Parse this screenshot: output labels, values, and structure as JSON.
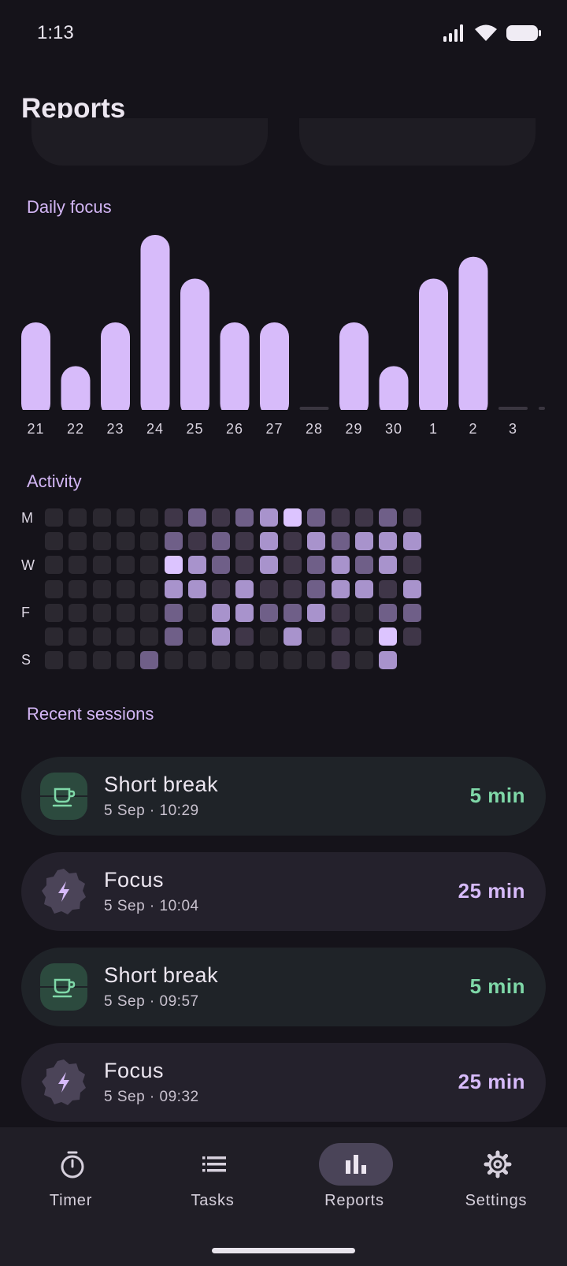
{
  "status_bar": {
    "time": "1:13"
  },
  "header": {
    "title": "Reports"
  },
  "daily_focus": {
    "title": "Daily focus"
  },
  "chart_data": {
    "type": "bar",
    "categories": [
      "21",
      "22",
      "23",
      "24",
      "25",
      "26",
      "27",
      "28",
      "29",
      "30",
      "1",
      "2",
      "3"
    ],
    "values": [
      2,
      1,
      2,
      4,
      3,
      2,
      2,
      0,
      2,
      1,
      3,
      3.5,
      0
    ],
    "ylim": [
      0,
      4
    ]
  },
  "activity": {
    "title": "Activity",
    "day_labels": [
      "M",
      "",
      "W",
      "",
      "F",
      "",
      "S"
    ],
    "levels": [
      [
        0,
        0,
        0,
        0,
        0,
        1,
        2,
        1,
        2,
        3,
        4,
        2,
        1,
        1,
        2,
        1
      ],
      [
        0,
        0,
        0,
        0,
        0,
        2,
        1,
        2,
        1,
        3,
        1,
        3,
        2,
        3,
        3,
        3
      ],
      [
        0,
        0,
        0,
        0,
        0,
        4,
        3,
        2,
        1,
        3,
        1,
        2,
        3,
        2,
        3,
        1
      ],
      [
        0,
        0,
        0,
        0,
        0,
        3,
        3,
        1,
        3,
        1,
        1,
        2,
        3,
        3,
        1,
        3
      ],
      [
        0,
        0,
        0,
        0,
        0,
        2,
        0,
        3,
        3,
        2,
        2,
        3,
        1,
        0,
        2,
        2
      ],
      [
        0,
        0,
        0,
        0,
        0,
        2,
        0,
        3,
        1,
        0,
        3,
        0,
        1,
        0,
        4,
        1
      ],
      [
        0,
        0,
        0,
        0,
        2,
        0,
        0,
        0,
        0,
        0,
        0,
        0,
        1,
        0,
        3,
        -1
      ]
    ]
  },
  "recent": {
    "title": "Recent sessions",
    "sessions": [
      {
        "type": "break",
        "title": "Short break",
        "time": "5 Sep · 10:29",
        "duration": "5 min"
      },
      {
        "type": "focus",
        "title": "Focus",
        "time": "5 Sep · 10:04",
        "duration": "25 min"
      },
      {
        "type": "break",
        "title": "Short break",
        "time": "5 Sep · 09:57",
        "duration": "5 min"
      },
      {
        "type": "focus",
        "title": "Focus",
        "time": "5 Sep · 09:32",
        "duration": "25 min"
      }
    ]
  },
  "nav": {
    "items": [
      {
        "label": "Timer",
        "icon": "timer-icon",
        "active": false
      },
      {
        "label": "Tasks",
        "icon": "list-icon",
        "active": false
      },
      {
        "label": "Reports",
        "icon": "bar-chart-icon",
        "active": true
      },
      {
        "label": "Settings",
        "icon": "gear-icon",
        "active": false
      }
    ]
  },
  "colors": {
    "accent": "#d7bbfa",
    "break_accent": "#7fd8a8",
    "background": "#15131a"
  }
}
